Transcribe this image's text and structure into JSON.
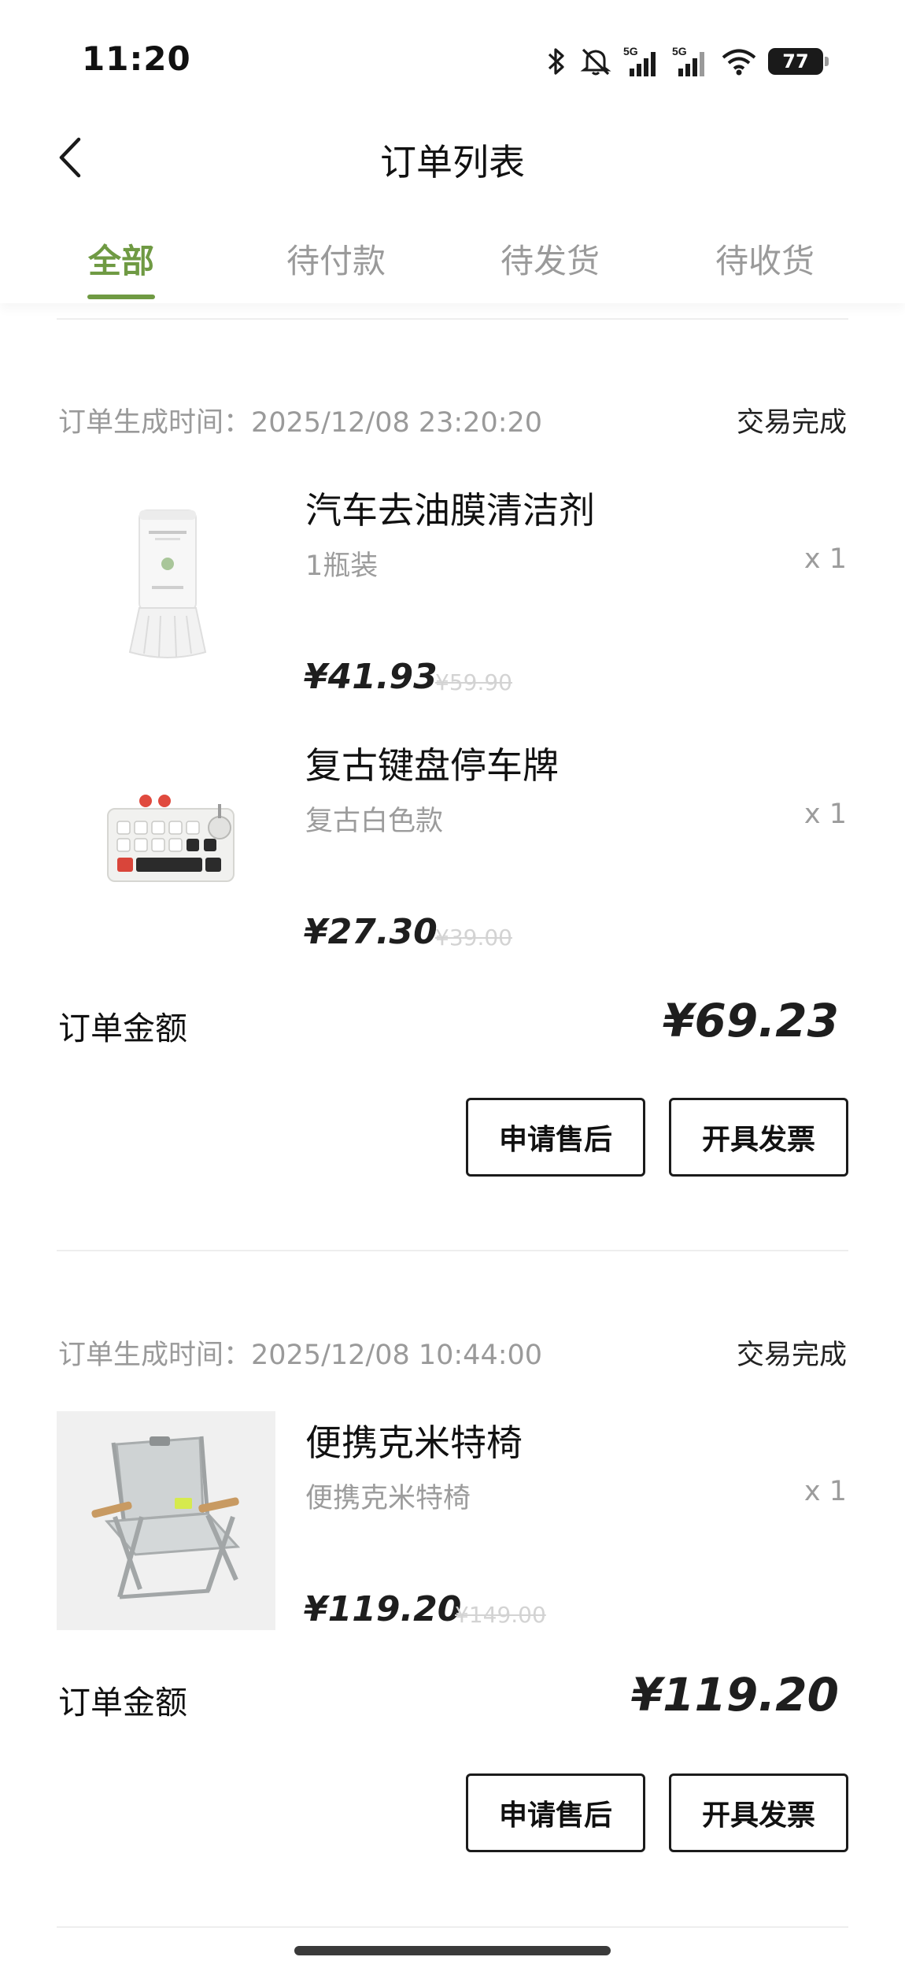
{
  "status_bar": {
    "time": "11:20",
    "battery": "77",
    "signal_label_1": "5G",
    "signal_label_2": "5G",
    "icons": [
      "bluetooth-icon",
      "mute-icon",
      "signal-5g-icon",
      "signal-5g-icon",
      "wifi-icon",
      "battery-icon"
    ]
  },
  "header": {
    "title": "订单列表",
    "back_icon": "chevron-left-icon"
  },
  "tabs": [
    {
      "label": "全部",
      "active": true
    },
    {
      "label": "待付款",
      "active": false
    },
    {
      "label": "待发货",
      "active": false
    },
    {
      "label": "待收货",
      "active": false
    }
  ],
  "colors": {
    "accent": "#6f9a43",
    "muted_text": "#9a9a9a",
    "primary_text": "#111111"
  },
  "orders": [
    {
      "time_label": "订单生成时间：2025/12/08 23:20:20",
      "status": "交易完成",
      "items": [
        {
          "name": "汽车去油膜清洁剂",
          "spec": "1瓶装",
          "qty": "x 1",
          "price": "¥41.93",
          "original_price": "¥59.90",
          "image": "cleaner-bottle-image"
        },
        {
          "name": "复古键盘停车牌",
          "spec": "复古白色款",
          "qty": "x 1",
          "price": "¥27.30",
          "original_price": "¥39.00",
          "image": "keyboard-parking-sign-image"
        }
      ],
      "total_label": "订单金额",
      "total": "¥69.23",
      "actions": [
        "申请售后",
        "开具发票"
      ]
    },
    {
      "time_label": "订单生成时间：2025/12/08 10:44:00",
      "status": "交易完成",
      "items": [
        {
          "name": "便携克米特椅",
          "spec": "便携克米特椅",
          "qty": "x 1",
          "price": "¥119.20",
          "original_price": "¥149.00",
          "image": "folding-chair-image"
        }
      ],
      "total_label": "订单金额",
      "total": "¥119.20",
      "actions": [
        "申请售后",
        "开具发票"
      ]
    }
  ]
}
